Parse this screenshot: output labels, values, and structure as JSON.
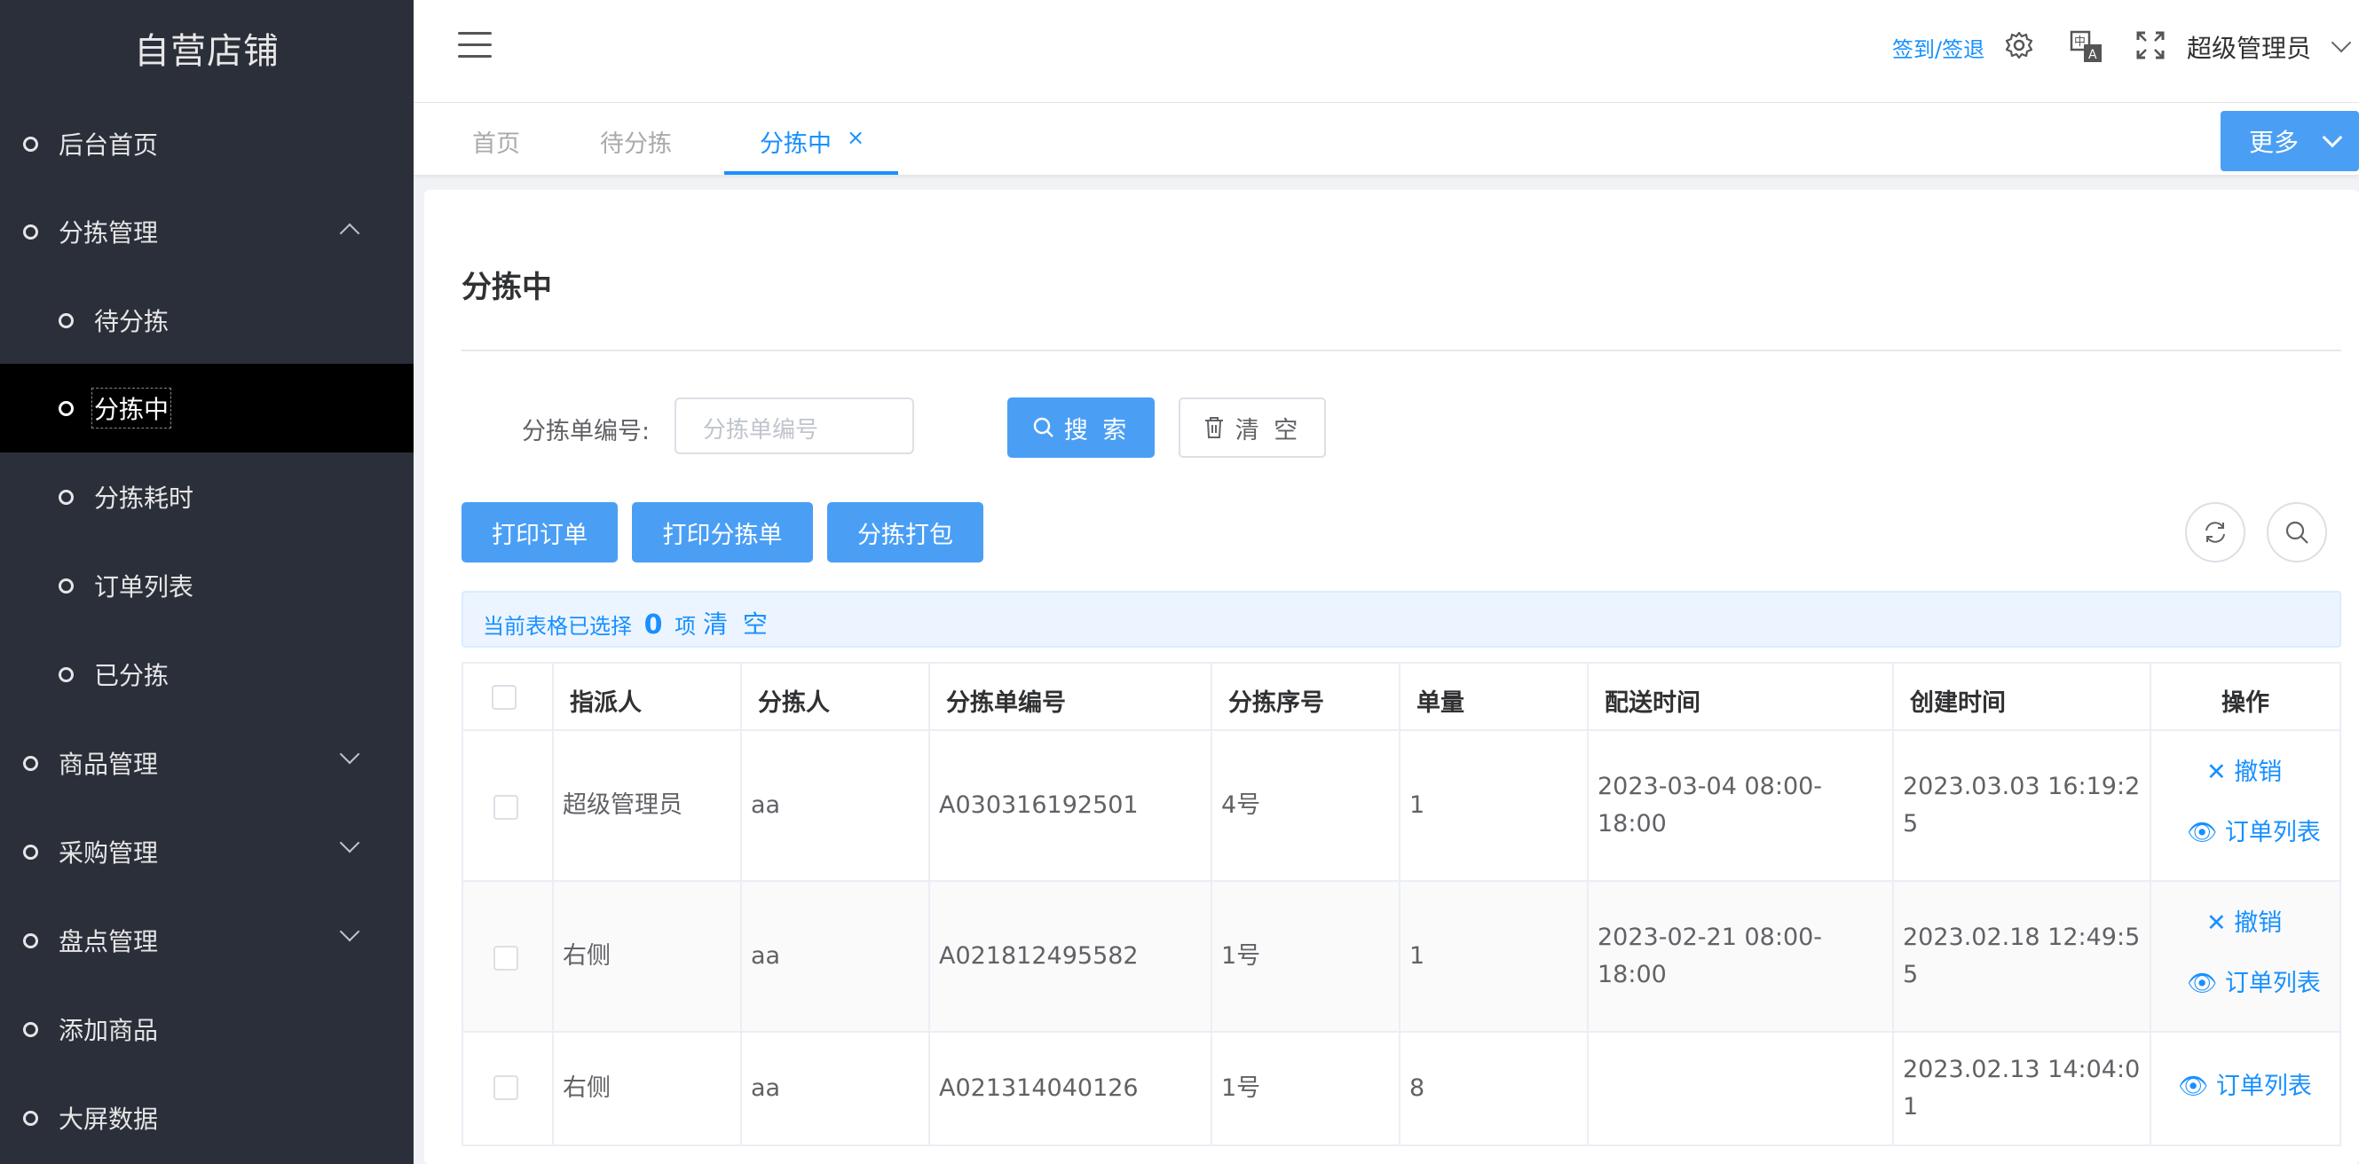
{
  "sidebar": {
    "brand": "自营店铺",
    "items": [
      {
        "label": "后台首页"
      },
      {
        "label": "分拣管理"
      },
      {
        "label": "待分拣"
      },
      {
        "label": "分拣中"
      },
      {
        "label": "分拣耗时"
      },
      {
        "label": "订单列表"
      },
      {
        "label": "已分拣"
      },
      {
        "label": "商品管理"
      },
      {
        "label": "采购管理"
      },
      {
        "label": "盘点管理"
      },
      {
        "label": "添加商品"
      },
      {
        "label": "大屏数据"
      }
    ]
  },
  "header": {
    "checkin_label": "签到/签退",
    "user_name": "超级管理员",
    "icons": [
      "menu-icon",
      "gear-icon",
      "translate-icon",
      "fullscreen-icon",
      "chevron-down-icon"
    ]
  },
  "tabs": {
    "items": [
      {
        "label": "首页"
      },
      {
        "label": "待分拣"
      },
      {
        "label": "分拣中"
      }
    ],
    "close_label": "×",
    "more_label": "更多"
  },
  "main": {
    "title": "分拣中",
    "search": {
      "label": "分拣单编号:",
      "placeholder": "分拣单编号",
      "search_label": "搜 索",
      "clear_label": "清 空"
    },
    "actions": {
      "print_order": "打印订单",
      "print_sort": "打印分拣单",
      "sort_pack": "分拣打包"
    },
    "selection": {
      "prefix": "当前表格已选择",
      "count": "0",
      "suffix": "项",
      "clear": "清 空"
    },
    "table": {
      "headers": [
        "指派人",
        "分拣人",
        "分拣单编号",
        "分拣序号",
        "单量",
        "配送时间",
        "创建时间",
        "操作"
      ],
      "rows": [
        {
          "assigner": "超级管理员",
          "sorter": "aa",
          "number": "A030316192501",
          "seq": "4号",
          "qty": "1",
          "delivery": "2023-03-04 08:00-18:00",
          "created": "2023.03.03 16:19:25",
          "cancel": "撤销",
          "view": "订单列表"
        },
        {
          "assigner": "右侧",
          "sorter": "aa",
          "number": "A021812495582",
          "seq": "1号",
          "qty": "1",
          "delivery": "2023-02-21 08:00-18:00",
          "created": "2023.02.18 12:49:55",
          "cancel": "撤销",
          "view": "订单列表"
        },
        {
          "assigner": "右侧",
          "sorter": "aa",
          "number": "A021314040126",
          "seq": "1号",
          "qty": "8",
          "delivery": "",
          "created": "2023.02.13 14:04:01",
          "view": "订单列表"
        }
      ]
    }
  },
  "colors": {
    "sidebar_bg": "#2b2f3a",
    "accent": "#1890ff",
    "button_primary": "#4a9ff5"
  }
}
